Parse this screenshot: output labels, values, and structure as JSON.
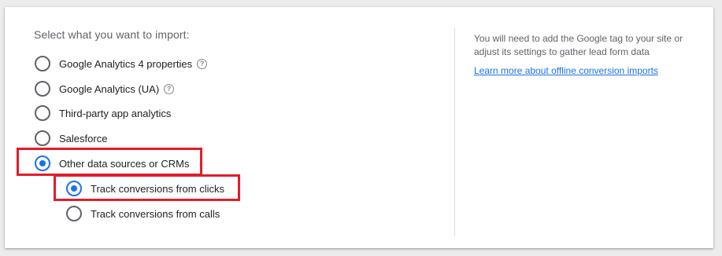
{
  "import": {
    "heading": "Select what you want to import:",
    "options": [
      {
        "label": "Google Analytics 4 properties",
        "selected": false,
        "has_help": true
      },
      {
        "label": "Google Analytics (UA)",
        "selected": false,
        "has_help": true
      },
      {
        "label": "Third-party app analytics",
        "selected": false,
        "has_help": false
      },
      {
        "label": "Salesforce",
        "selected": false,
        "has_help": false
      },
      {
        "label": "Other data sources or CRMs",
        "selected": true,
        "has_help": false
      }
    ],
    "sub_options": [
      {
        "label": "Track conversions from clicks",
        "selected": true
      },
      {
        "label": "Track conversions from calls",
        "selected": false
      }
    ]
  },
  "info_panel": {
    "text": "You will need to add the Google tag to your site or adjust its settings to gather lead form data",
    "link_text": "Learn more about offline conversion imports"
  },
  "colors": {
    "accent": "#1a73e8",
    "highlight": "#e21c2a",
    "text_primary": "#202124",
    "text_secondary": "#5f6368"
  }
}
